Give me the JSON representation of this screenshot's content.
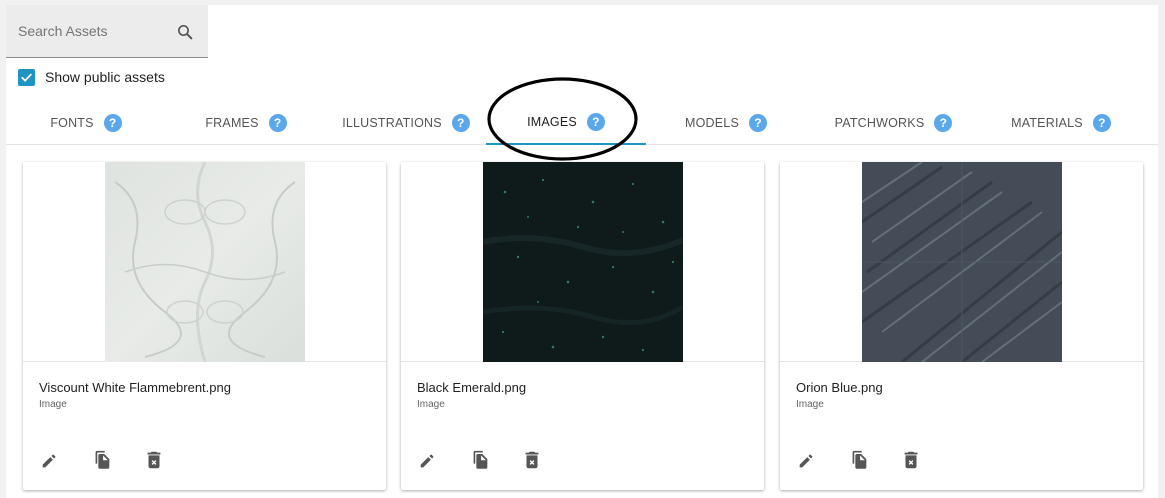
{
  "search": {
    "placeholder": "Search Assets",
    "icon": "search-icon"
  },
  "public_assets": {
    "label": "Show public assets",
    "checked": true
  },
  "tabs": [
    {
      "label": "FONTS"
    },
    {
      "label": "FRAMES"
    },
    {
      "label": "ILLUSTRATIONS"
    },
    {
      "label": "IMAGES",
      "active": true
    },
    {
      "label": "MODELS"
    },
    {
      "label": "PATCHWORKS"
    },
    {
      "label": "MATERIALS"
    }
  ],
  "help_glyph": "?",
  "cards": [
    {
      "title": "Viscount White Flammebrent.png",
      "type": "Image"
    },
    {
      "title": "Black Emerald.png",
      "type": "Image"
    },
    {
      "title": "Orion Blue.png",
      "type": "Image"
    }
  ],
  "card_actions": [
    "pencil-icon",
    "copy-icon",
    "delete-icon"
  ],
  "colors": {
    "accent": "#1f93c4",
    "help": "#5aa7ea",
    "annotation": "#000000"
  }
}
